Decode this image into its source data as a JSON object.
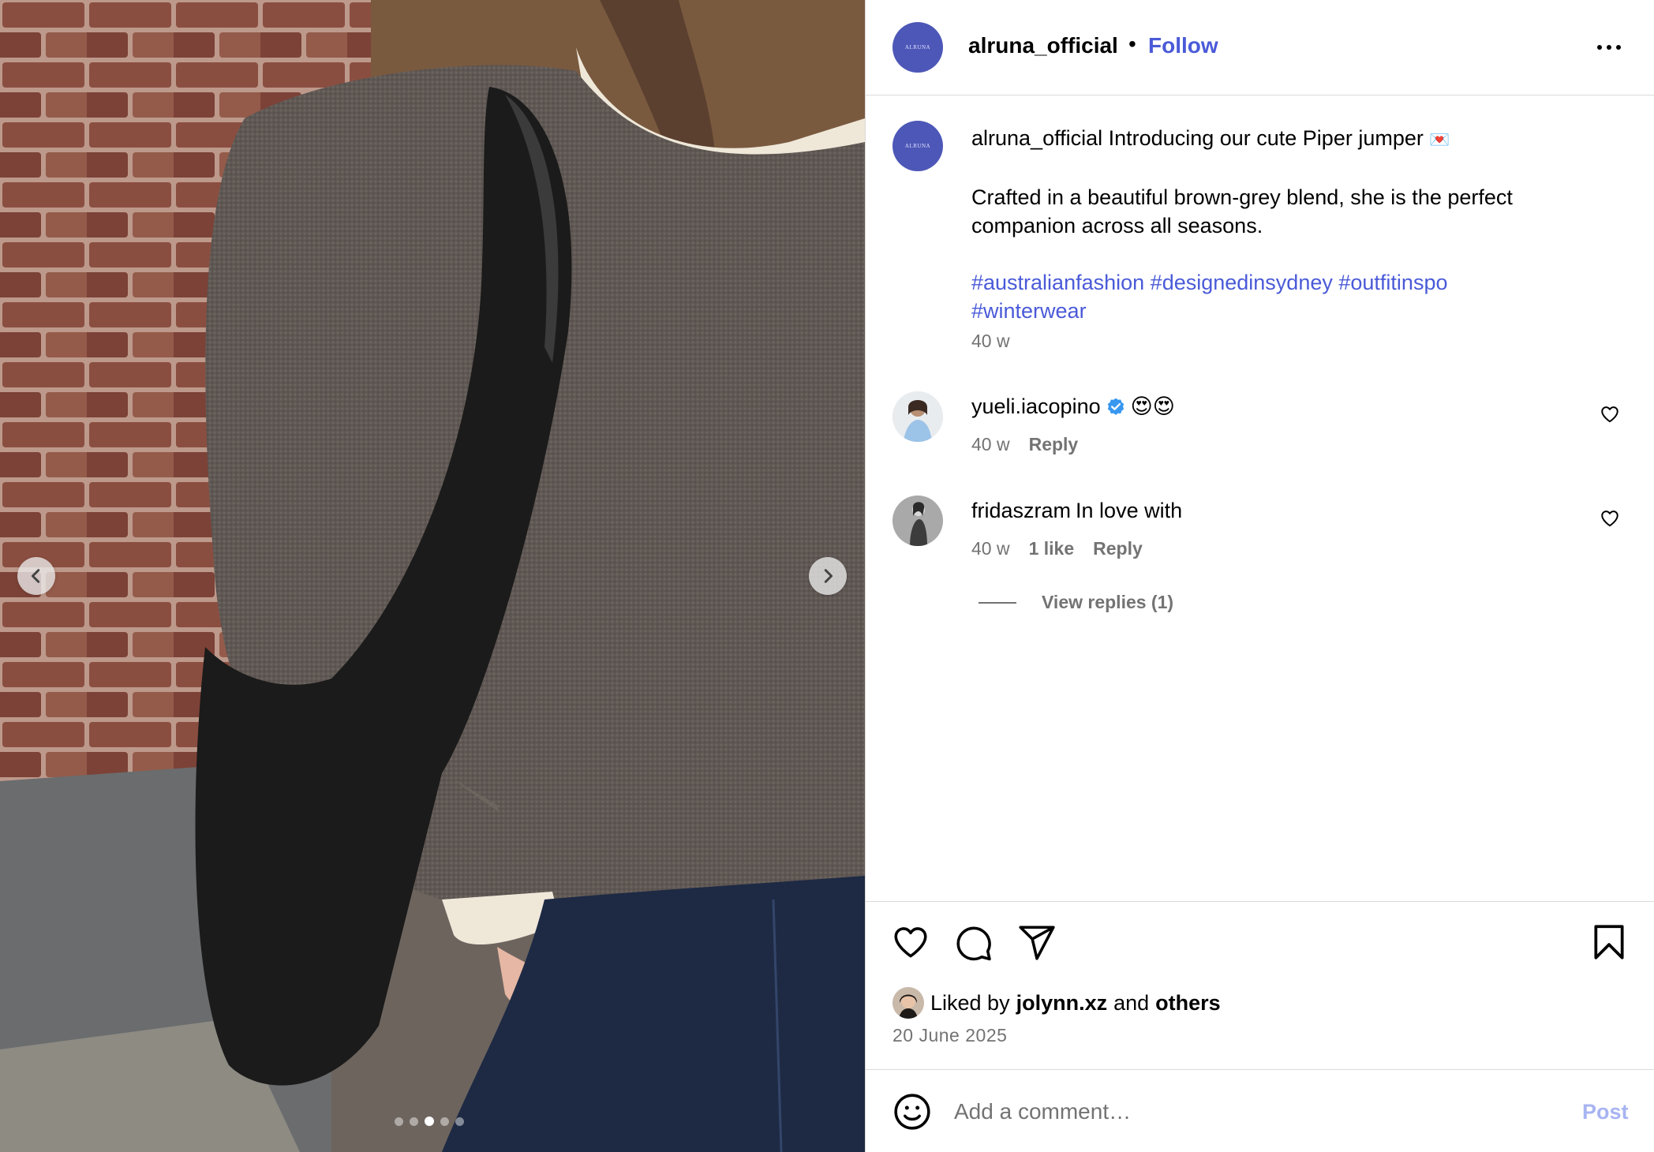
{
  "post": {
    "brand_avatar_text": "ALRUNA",
    "username": "alruna_official",
    "separator": "•",
    "follow_label": "Follow",
    "caption": {
      "username": "alruna_official",
      "line1": "Introducing our cute Piper jumper",
      "line1_emoji": "💌",
      "line2": "Crafted in a beautiful brown-grey blend, she is the perfect",
      "line3": "companion across all seasons.",
      "hashtags": [
        "#australianfashion",
        "#designedinsydney",
        "#outfitinspo",
        "#winterwear"
      ],
      "time": "40 w"
    },
    "comments": [
      {
        "username": "yueli.iacopino",
        "verified": true,
        "text": "😍😍",
        "time": "40 w",
        "likes": "",
        "reply_label": "Reply"
      },
      {
        "username": "fridaszram",
        "verified": false,
        "text": "In love with",
        "time": "40 w",
        "likes": "1 like",
        "reply_label": "Reply"
      }
    ],
    "view_replies_label": "View replies (1)",
    "liked_by": {
      "prefix": "Liked by",
      "user": "jolynn.xz",
      "and": "and",
      "others": "others"
    },
    "date": "20 June 2025",
    "composer": {
      "placeholder": "Add a comment…",
      "post_label": "Post"
    }
  },
  "carousel": {
    "total_slides": 5,
    "active_index": 2
  },
  "icons": {
    "prev": "chevron-left-icon",
    "next": "chevron-right-icon",
    "more": "more-horizontal-icon",
    "like": "heart-icon",
    "comment": "comment-bubble-icon",
    "share": "paper-plane-icon",
    "save": "bookmark-icon",
    "emoji": "smiley-icon",
    "verified": "verified-badge-icon"
  },
  "colors": {
    "link_blue": "#4a5ad8",
    "brand_avatar": "#4d57b7",
    "muted": "#737373",
    "post_disabled": "#a7b4f2",
    "verified_blue": "#3897f0"
  }
}
